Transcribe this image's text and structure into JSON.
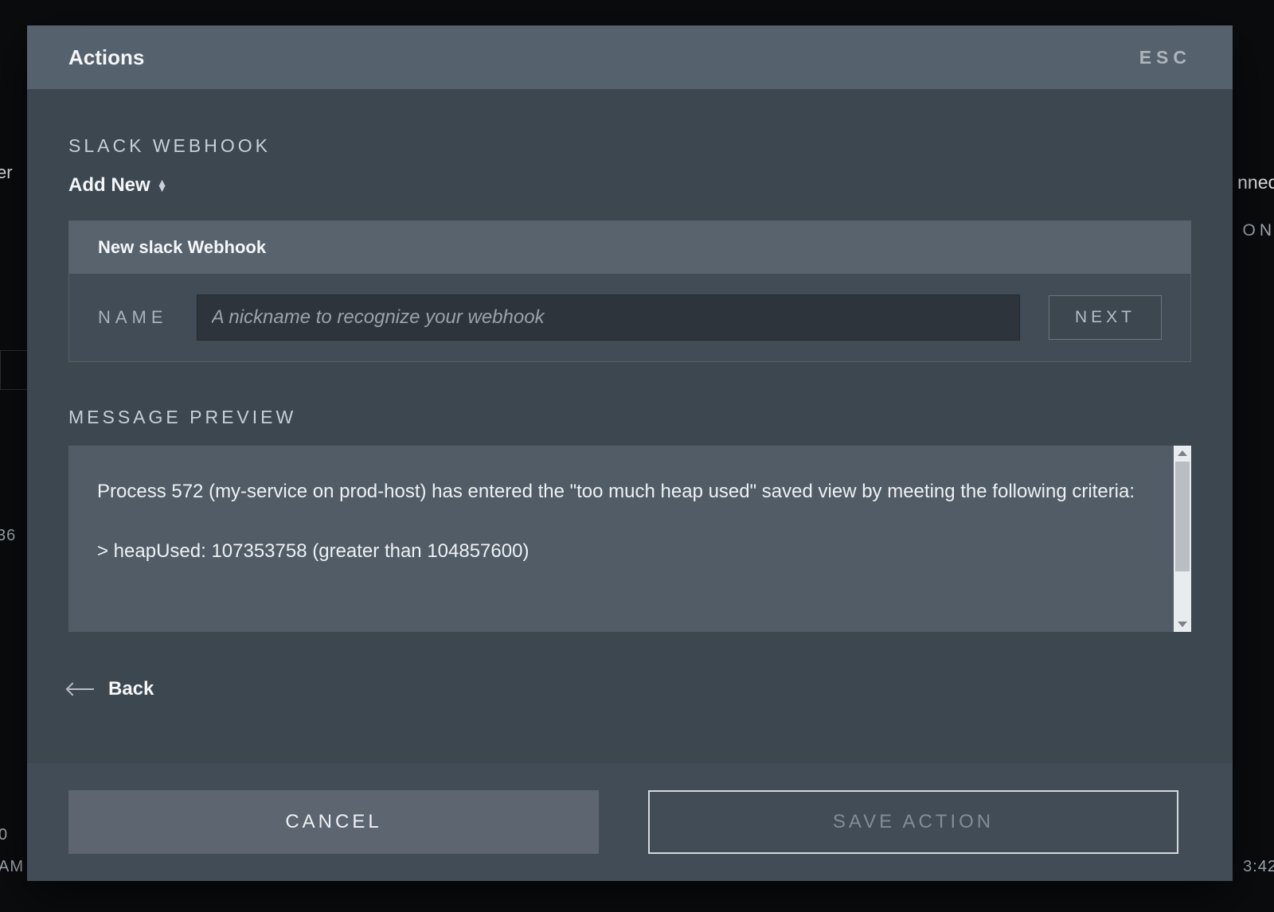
{
  "background": {
    "left_text": "er",
    "right_text": "nnec",
    "on_text": "ON",
    "num_36": "36",
    "zero": "0",
    "time_left": "AM",
    "time_right": "3:42"
  },
  "modal": {
    "title": "Actions",
    "esc_label": "ESC"
  },
  "section": {
    "slack_webhook_label": "SLACK WEBHOOK",
    "add_new_label": "Add New"
  },
  "webhook_form": {
    "header": "New slack Webhook",
    "name_label": "NAME",
    "name_placeholder": "A nickname to recognize your webhook",
    "name_value": "",
    "next_label": "NEXT"
  },
  "preview": {
    "label": "MESSAGE PREVIEW",
    "line1": "Process 572 (my-service on prod-host) has entered the \"too much heap used\" saved view by meeting the following criteria:",
    "line2": "> heapUsed: 107353758 (greater than 104857600)"
  },
  "back": {
    "label": "Back"
  },
  "footer": {
    "cancel_label": "CANCEL",
    "save_label": "SAVE ACTION"
  }
}
